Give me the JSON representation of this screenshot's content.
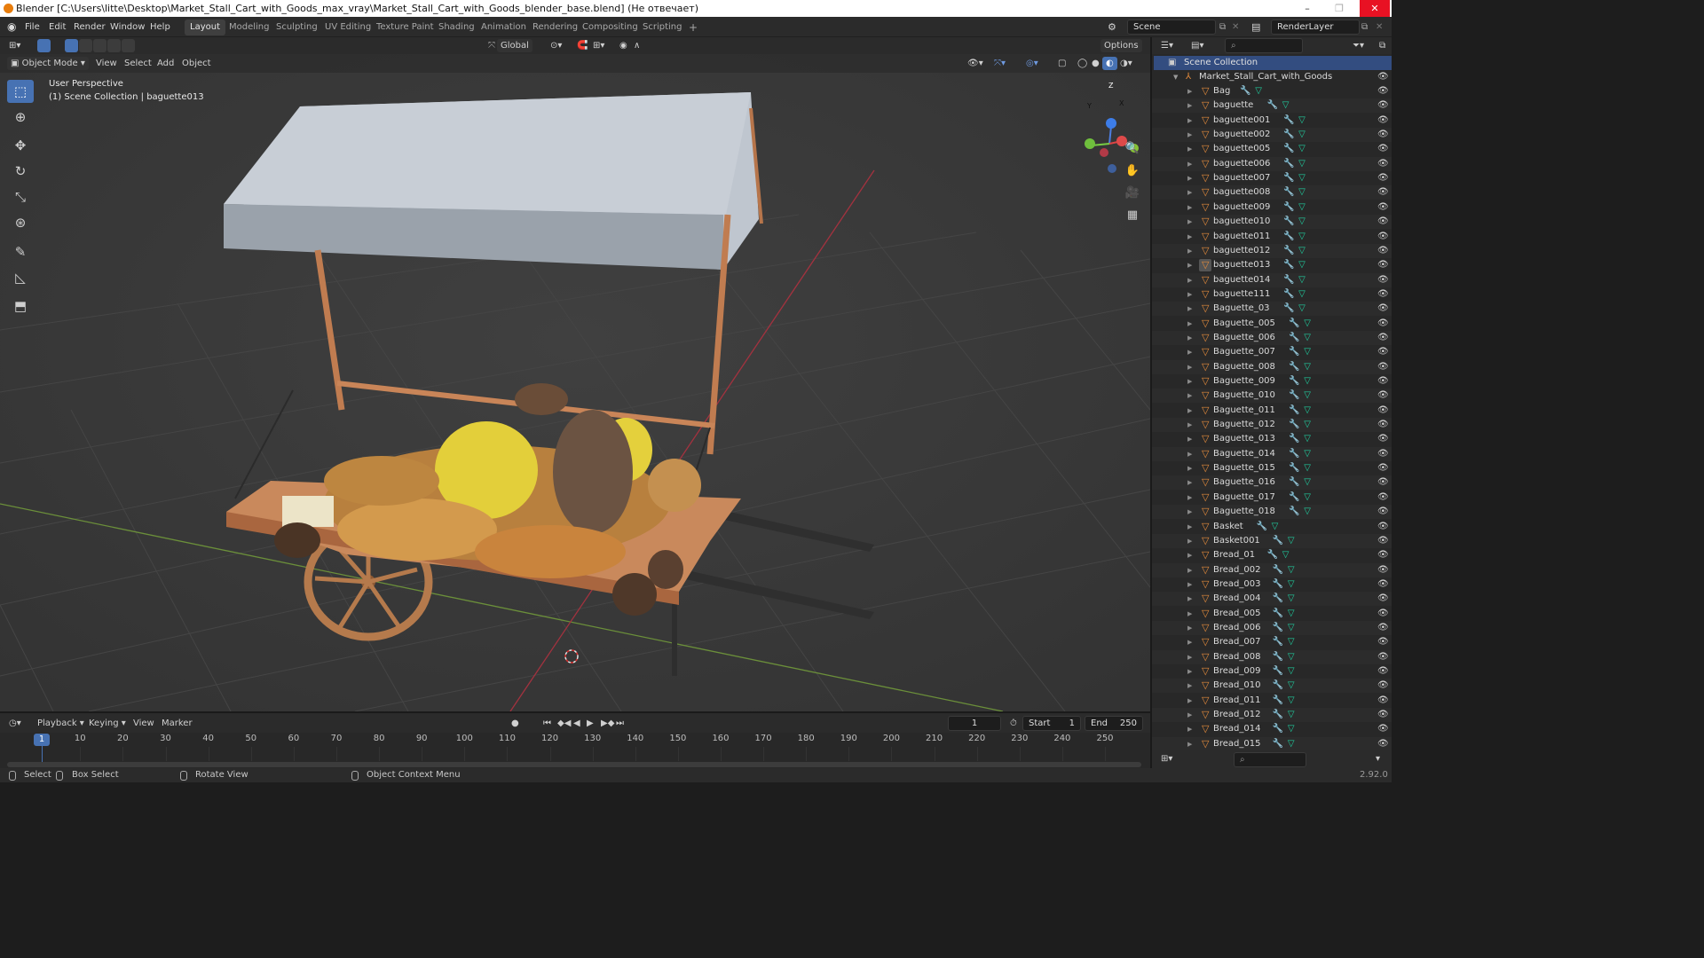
{
  "window": {
    "title": "Blender [C:\\Users\\litte\\Desktop\\Market_Stall_Cart_with_Goods_max_vray\\Market_Stall_Cart_with_Goods_blender_base.blend] (Не отвечает)",
    "min": "–",
    "max": "❐",
    "close": "✕"
  },
  "menubar": {
    "items": [
      "File",
      "Edit",
      "Render",
      "Window",
      "Help"
    ]
  },
  "workspaces": [
    "Layout",
    "Modeling",
    "Sculpting",
    "UV Editing",
    "Texture Paint",
    "Shading",
    "Animation",
    "Rendering",
    "Compositing",
    "Scripting"
  ],
  "add_workspace": "+",
  "scene": {
    "label": "Scene",
    "render_layer": "RenderLayer"
  },
  "viewport_header": {
    "orientation": "Global",
    "options": "Options",
    "mode": "Object Mode",
    "menus": [
      "View",
      "Select",
      "Add",
      "Object"
    ]
  },
  "viewport": {
    "perspective": "User Perspective",
    "collection_info": "(1) Scene Collection | baguette013",
    "gizmo": {
      "z": "Z",
      "y": "Y",
      "x": "X"
    }
  },
  "tools": [
    {
      "name": "select-box-tool",
      "glyph": "⬚"
    },
    {
      "name": "cursor-tool",
      "glyph": "⊕"
    },
    {
      "name": "move-tool",
      "glyph": "✥"
    },
    {
      "name": "rotate-tool",
      "glyph": "↻"
    },
    {
      "name": "scale-tool",
      "glyph": "⤡"
    },
    {
      "name": "transform-tool",
      "glyph": "⊛"
    },
    {
      "name": "annotate-tool",
      "glyph": "✎"
    },
    {
      "name": "measure-tool",
      "glyph": "📐"
    },
    {
      "name": "add-cube-tool",
      "glyph": "⬒"
    }
  ],
  "outliner": {
    "scene_collection": "Scene Collection",
    "root": "Market_Stall_Cart_with_Goods",
    "items": [
      "Bag",
      "baguette",
      "baguette001",
      "baguette002",
      "baguette005",
      "baguette006",
      "baguette007",
      "baguette008",
      "baguette009",
      "baguette010",
      "baguette011",
      "baguette012",
      "baguette013",
      "baguette014",
      "baguette111",
      "Baguette_03",
      "Baguette_005",
      "Baguette_006",
      "Baguette_007",
      "Baguette_008",
      "Baguette_009",
      "Baguette_010",
      "Baguette_011",
      "Baguette_012",
      "Baguette_013",
      "Baguette_014",
      "Baguette_015",
      "Baguette_016",
      "Baguette_017",
      "Baguette_018",
      "Basket",
      "Basket001",
      "Bread_01",
      "Bread_002",
      "Bread_003",
      "Bread_004",
      "Bread_005",
      "Bread_006",
      "Bread_007",
      "Bread_008",
      "Bread_009",
      "Bread_010",
      "Bread_011",
      "Bread_012",
      "Bread_014",
      "Bread_015"
    ],
    "selected": "baguette013"
  },
  "timeline": {
    "menus": [
      "Playback",
      "Keying",
      "View",
      "Marker"
    ],
    "current_frame": "1",
    "start_label": "Start",
    "start": "1",
    "end_label": "End",
    "end": "250",
    "ticks": [
      "10",
      "20",
      "30",
      "40",
      "50",
      "60",
      "70",
      "80",
      "90",
      "100",
      "110",
      "120",
      "130",
      "140",
      "150",
      "160",
      "170",
      "180",
      "190",
      "200",
      "210",
      "220",
      "230",
      "240",
      "250"
    ]
  },
  "statusbar": {
    "select": "Select",
    "box_select": "Box Select",
    "rotate_view": "Rotate View",
    "context_menu": "Object Context Menu",
    "version": "2.92.0"
  },
  "colors": {
    "accent": "#4772b3",
    "object_icon": "#e48b3c",
    "mesh_icon": "#1fd0a0",
    "modifier_icon": "#6f8fc9"
  }
}
